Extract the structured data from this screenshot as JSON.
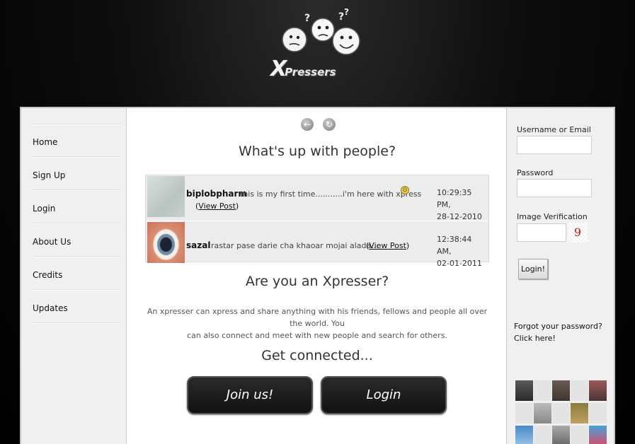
{
  "brand": {
    "logo_letter": "X",
    "logo_word": "Pressers"
  },
  "nav": [
    "Home",
    "Sign Up",
    "Login",
    "About Us",
    "Credits",
    "Updates"
  ],
  "feed": {
    "heading": "What's up with people?",
    "posts": [
      {
        "user": "biplobpharm",
        "text": "this is my first time...........i'm here with xpress",
        "view_open": "(",
        "view_label": "View Post",
        "view_close": ")",
        "time": "10:29:35 PM,",
        "date": "28-12-2010"
      },
      {
        "user": "sazal",
        "text": "rastar pase darie cha khaoar mojai alada...",
        "view_open": "(",
        "view_label": "View Post",
        "view_close": ")",
        "time": "12:38:44 AM,",
        "date": "02-01-2011"
      }
    ]
  },
  "about": {
    "heading": "Are you an Xpresser?",
    "line1": "An xpresser can xpress and share anything with his friends, fellows and people all over the world. You",
    "line2": "can also connect and meet with new people and search for others."
  },
  "connect": {
    "heading": "Get connected...",
    "join_label": "Join us!",
    "login_label": "Login"
  },
  "login_form": {
    "username_label": "Username or Email",
    "password_label": "Password",
    "captcha_label": "Image Verification",
    "captcha_value": "9",
    "submit_label": "Login!",
    "forgot_line1": "Forgot your password?",
    "forgot_line2": "Click here!"
  },
  "colors": {
    "background": "#000000",
    "button_dark": "#1a1a1a",
    "panel": "#f0f0f0"
  }
}
